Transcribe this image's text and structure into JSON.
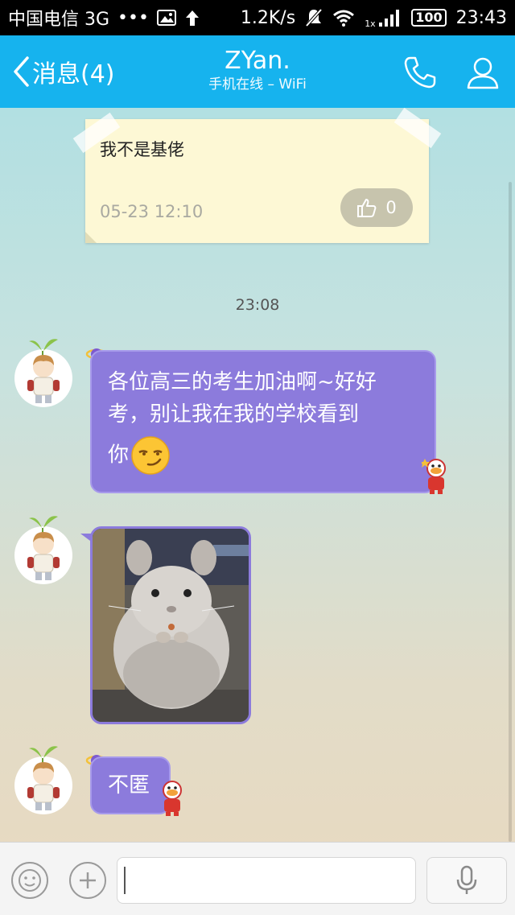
{
  "status_bar": {
    "carrier": "中国电信 3G",
    "dots": "•••",
    "speed": "1.2K/s",
    "signal_label": "1x",
    "battery": "100",
    "time": "23:43"
  },
  "header": {
    "back_label": "消息(4)",
    "title": "ZYan.",
    "subtitle": "手机在线 – WiFi",
    "accent_color": "#16b3ee"
  },
  "note": {
    "text": "我不是基佬",
    "time": "05-23 12:10",
    "like_count": "0"
  },
  "time_separator": "23:08",
  "messages": [
    {
      "type": "text",
      "text_line1": "各位高三的考生加油啊~好好",
      "text_line2": "考，别让我在我的学校看到",
      "text_line3": "你"
    },
    {
      "type": "image",
      "subject": "chinchilla photo"
    },
    {
      "type": "text",
      "text": "不匿"
    }
  ],
  "bubble_color": "#8c7bdc",
  "input_bar": {
    "placeholder": "",
    "value": ""
  }
}
